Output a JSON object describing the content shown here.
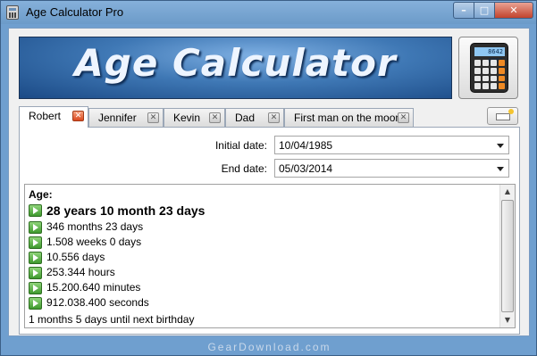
{
  "window": {
    "title": "Age Calculator Pro",
    "buttons": {
      "minimize": "–",
      "maximize": "□",
      "close": "✕"
    }
  },
  "banner": {
    "text": "Age Calculator"
  },
  "calc_icon": {
    "screen": "8642 0000"
  },
  "tabs": [
    {
      "label": "Robert",
      "active": true
    },
    {
      "label": "Jennifer",
      "active": false
    },
    {
      "label": "Kevin",
      "active": false
    },
    {
      "label": "Dad",
      "active": false
    },
    {
      "label": "First man on the moon",
      "active": false
    }
  ],
  "tab_close_glyph": "✕",
  "form": {
    "initial_date_label": "Initial date:",
    "initial_date_value": "10/04/1985",
    "end_date_label": "End date:",
    "end_date_value": "05/03/2014"
  },
  "results": {
    "heading": "Age:",
    "main": "28 years 10 month 23 days",
    "rows": [
      "346 months 23 days",
      "1.508 weeks 0 days",
      "10.556 days",
      "253.344 hours",
      "15.200.640 minutes",
      "912.038.400 seconds"
    ],
    "birthday_note": "1 months 5 days until next birthday"
  },
  "scrollbar": {
    "up": "▲",
    "down": "▼"
  },
  "watermark": "GearDownload.com",
  "colors": {
    "title_bar": "#6c9bc9",
    "banner": "#3f78b5",
    "active_tab_close": "#d9471d",
    "arrow_icon": "#3f9a2e"
  }
}
